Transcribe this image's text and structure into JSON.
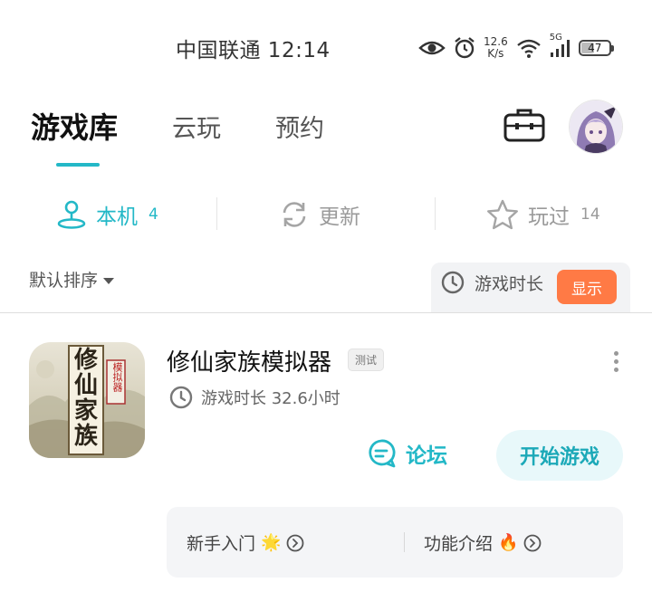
{
  "status_bar": {
    "carrier_time": "中国联通 12:14",
    "net_speed_value": "12.6",
    "net_speed_unit": "K/s",
    "network": "5G",
    "battery": "47",
    "battery_level": 0.47
  },
  "tabs": {
    "library": "游戏库",
    "cloud": "云玩",
    "reserve": "预约"
  },
  "subtabs": {
    "local_label": "本机",
    "local_count": "4",
    "update_label": "更新",
    "played_label": "玩过",
    "played_count": "14"
  },
  "sort": {
    "label": "默认排序",
    "playtime_label": "游戏时长",
    "show_button": "显示"
  },
  "game": {
    "title": "修仙家族模拟器",
    "badge": "测试",
    "playtime": "游戏时长 32.6小时",
    "forum_label": "论坛",
    "start_button": "开始游戏",
    "icon_text": [
      "修",
      "仙",
      "家",
      "族"
    ],
    "icon_tag": "模拟器"
  },
  "guides": {
    "newbie": "新手入门",
    "newbie_emoji": "🌟",
    "features": "功能介绍",
    "features_emoji": "🔥"
  },
  "colors": {
    "accent": "#23b8c7",
    "orange": "#ff7a45"
  }
}
